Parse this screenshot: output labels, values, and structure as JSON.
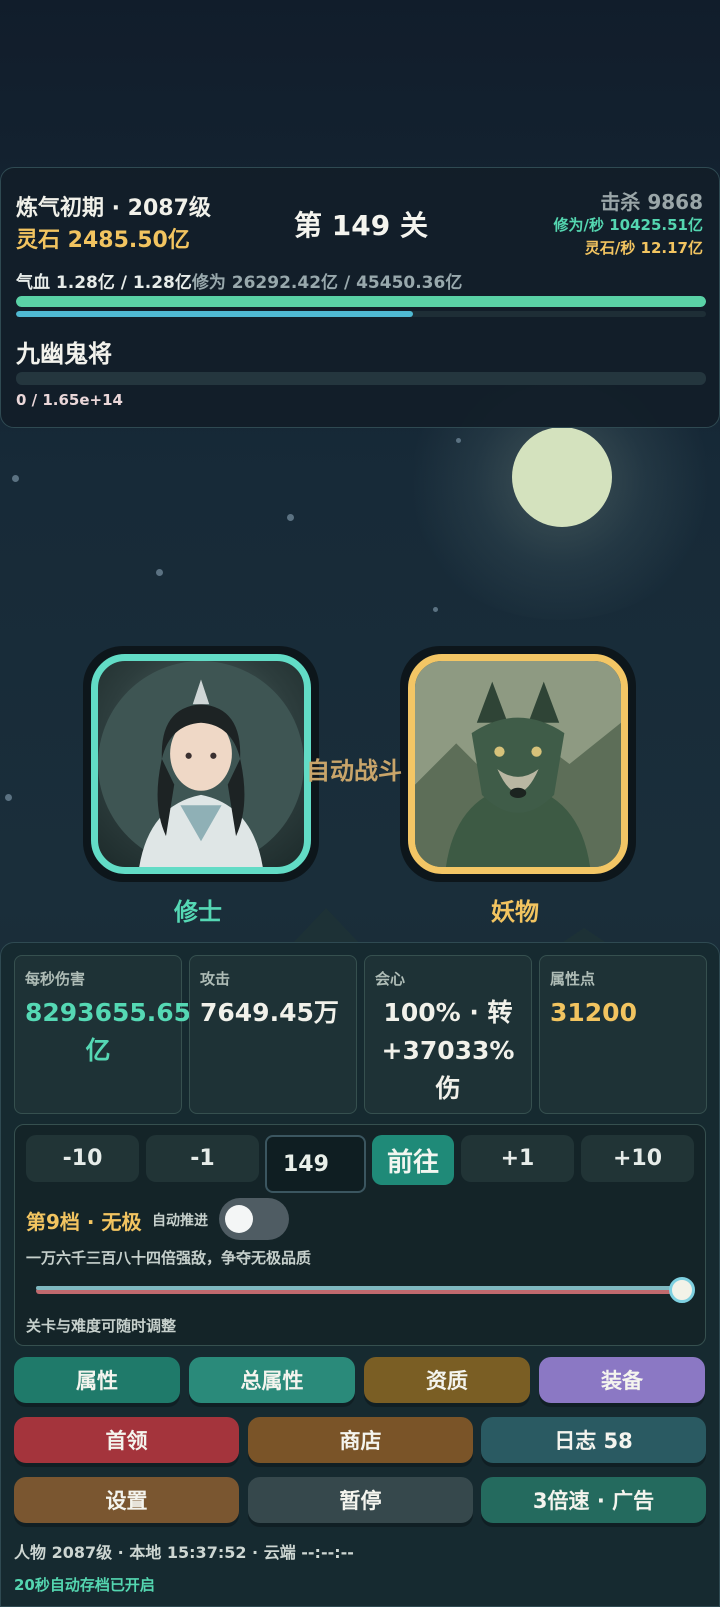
{
  "hud": {
    "realm": "炼气初期 · 2087级",
    "spirit_stones": "灵石 2485.50亿",
    "stage_title": "第 149 关",
    "kills": "击杀 9868",
    "cultivation_per_sec": "修为/秒 10425.51亿",
    "stones_per_sec": "灵石/秒 12.17亿",
    "hp_text": "气血 1.28亿 / 1.28亿",
    "xp_text": "修为 26292.42亿 / 45450.36亿",
    "hp_fraction": 1.0,
    "xp_fraction": 0.575,
    "enemy_name": "九幽鬼将",
    "enemy_hp_text": "0 / 1.65e+14",
    "enemy_hp_fraction": 0.0
  },
  "battle": {
    "player_label": "修士",
    "monster_label": "妖物",
    "auto_battle": "自动战斗"
  },
  "stats": [
    {
      "title": "每秒伤害",
      "value": "8293655.65亿",
      "color": "#55d8b4"
    },
    {
      "title": "攻击",
      "value": "7649.45万",
      "color": "#f1f1ea"
    },
    {
      "title": "会心",
      "value": "100% · 转+37033%伤",
      "color": "#f1f1ea"
    },
    {
      "title": "属性点",
      "value": "31200",
      "color": "#f2c460"
    }
  ],
  "stage_control": {
    "minus10": "-10",
    "minus1": "-1",
    "stage_value": "149",
    "go": "前往",
    "plus1": "+1",
    "plus10": "+10",
    "tier": "第9档 · 无极",
    "auto_advance": "自动推进",
    "auto_advance_on": false,
    "tier_desc": "一万六千三百八十四倍强敌，争夺无极品质",
    "difficulty_level": 1.0,
    "hint": "关卡与难度可随时调整"
  },
  "menu": {
    "attributes": "属性",
    "total_attributes": "总属性",
    "aptitude": "资质",
    "equipment": "装备",
    "boss": "首领",
    "shop": "商店",
    "log": "日志 58",
    "settings": "设置",
    "pause": "暂停",
    "speed_ad": "3倍速 · 广告"
  },
  "footer": {
    "status": "人物 2087级 · 本地 15:37:52 · 云端 --:--:--",
    "autosave": "20秒自动存档已开启"
  },
  "colors": {
    "accent_teal": "#55d8b4",
    "gold": "#f2c460",
    "purple": "#8b78c4",
    "red": "#a4343c"
  }
}
